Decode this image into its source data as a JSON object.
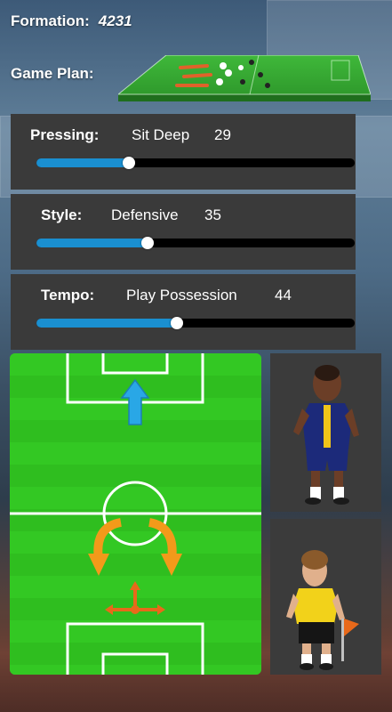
{
  "formation": {
    "label": "Formation:",
    "value": "4231"
  },
  "game_plan": {
    "label": "Game Plan:"
  },
  "sliders": [
    {
      "key": "pressing",
      "label": "Pressing:",
      "setting": "Sit Deep",
      "value": "29",
      "level": 0.29
    },
    {
      "key": "style",
      "label": "Style:",
      "setting": "Defensive",
      "value": "35",
      "level": 0.35
    },
    {
      "key": "tempo",
      "label": "Tempo:",
      "setting": "Play Possession",
      "value": "44",
      "level": 0.44
    }
  ],
  "colors": {
    "pitch_green": "#2fbe1f",
    "slider_fill": "#1a8fd0",
    "panel": "#3a3a3a",
    "arrow_blue": "#29a7e6",
    "arrow_orange": "#f29a1a"
  },
  "players": [
    {
      "name": "player-attacker",
      "kit": "navy-yellow-stripe"
    },
    {
      "name": "player-midfielder",
      "kit": "yellow-black"
    }
  ]
}
